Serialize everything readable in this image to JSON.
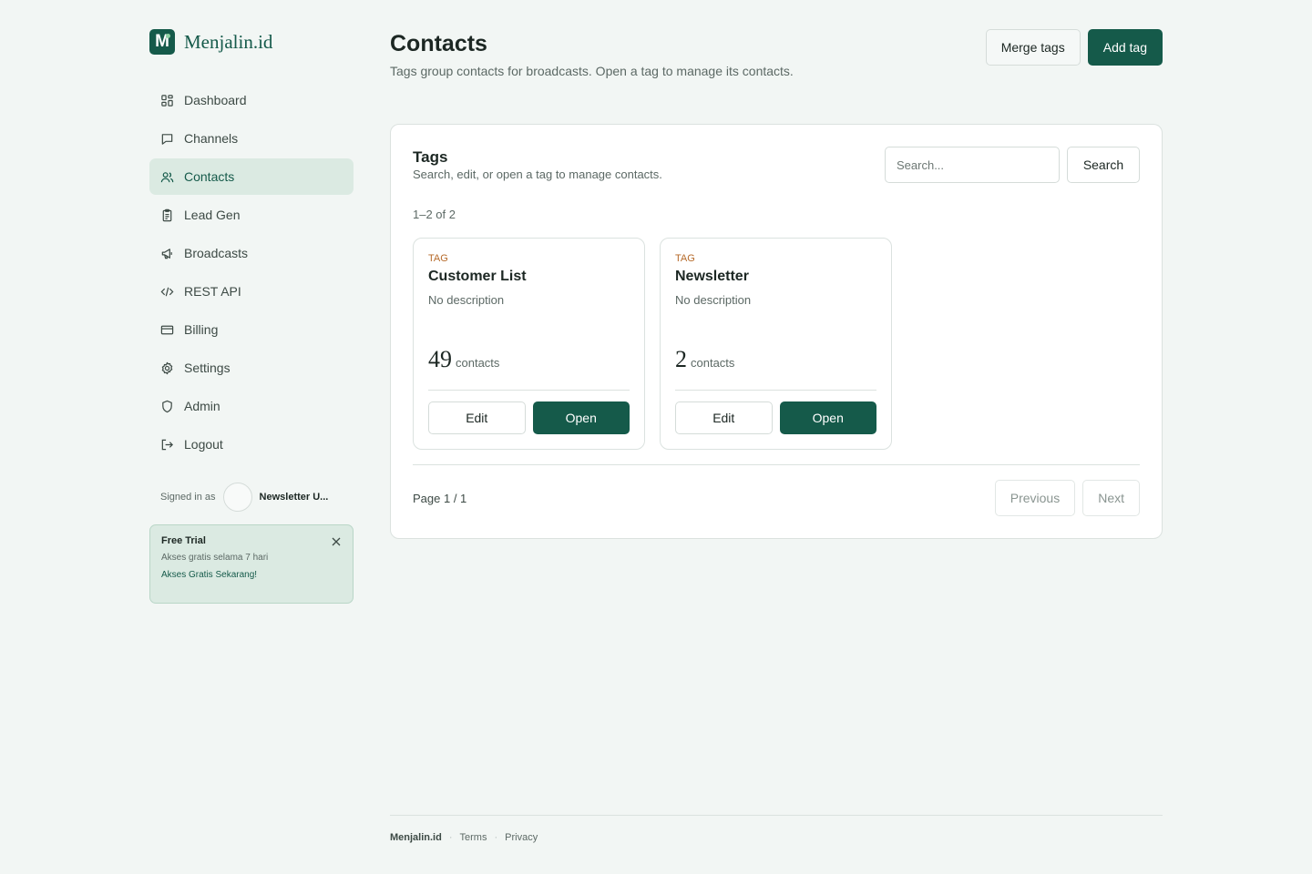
{
  "brand": {
    "logo_letter": "M",
    "name": "Menjalin.id"
  },
  "sidebar": {
    "items": [
      {
        "label": "Dashboard",
        "icon": "grid-icon"
      },
      {
        "label": "Channels",
        "icon": "message-icon"
      },
      {
        "label": "Contacts",
        "icon": "users-icon",
        "active": true
      },
      {
        "label": "Lead Gen",
        "icon": "clipboard-icon"
      },
      {
        "label": "Broadcasts",
        "icon": "megaphone-icon"
      },
      {
        "label": "REST API",
        "icon": "code-icon"
      },
      {
        "label": "Billing",
        "icon": "credit-card-icon"
      },
      {
        "label": "Settings",
        "icon": "gear-icon"
      },
      {
        "label": "Admin",
        "icon": "shield-icon"
      },
      {
        "label": "Logout",
        "icon": "logout-icon"
      }
    ],
    "signed_in_label": "Signed in as",
    "user_name": "Newsletter U...",
    "trial": {
      "title": "Free Trial",
      "text": "Akses gratis selama 7 hari",
      "link": "Akses Gratis Sekarang!"
    }
  },
  "header": {
    "title": "Contacts",
    "subtitle": "Tags group contacts for broadcasts. Open a tag to manage its contacts.",
    "merge_label": "Merge tags",
    "add_label": "Add tag"
  },
  "panel": {
    "title": "Tags",
    "subtitle": "Search, edit, or open a tag to manage contacts.",
    "search_placeholder": "Search...",
    "search_button": "Search",
    "range_text": "1–2 of 2",
    "tags": [
      {
        "kicker": "TAG",
        "name": "Customer List",
        "description": "No description",
        "count": "49",
        "count_label": "contacts",
        "edit_label": "Edit",
        "open_label": "Open"
      },
      {
        "kicker": "TAG",
        "name": "Newsletter",
        "description": "No description",
        "count": "2",
        "count_label": "contacts",
        "edit_label": "Edit",
        "open_label": "Open"
      }
    ],
    "page_info": "Page 1 / 1",
    "previous_label": "Previous",
    "next_label": "Next"
  },
  "footer": {
    "brand": "Menjalin.id",
    "separator": "·",
    "terms": "Terms",
    "privacy": "Privacy"
  },
  "colors": {
    "primary": "#155a4a",
    "background": "#f2f6f4",
    "active_bg": "#dbeae2",
    "tag_accent": "#b66a2a"
  }
}
